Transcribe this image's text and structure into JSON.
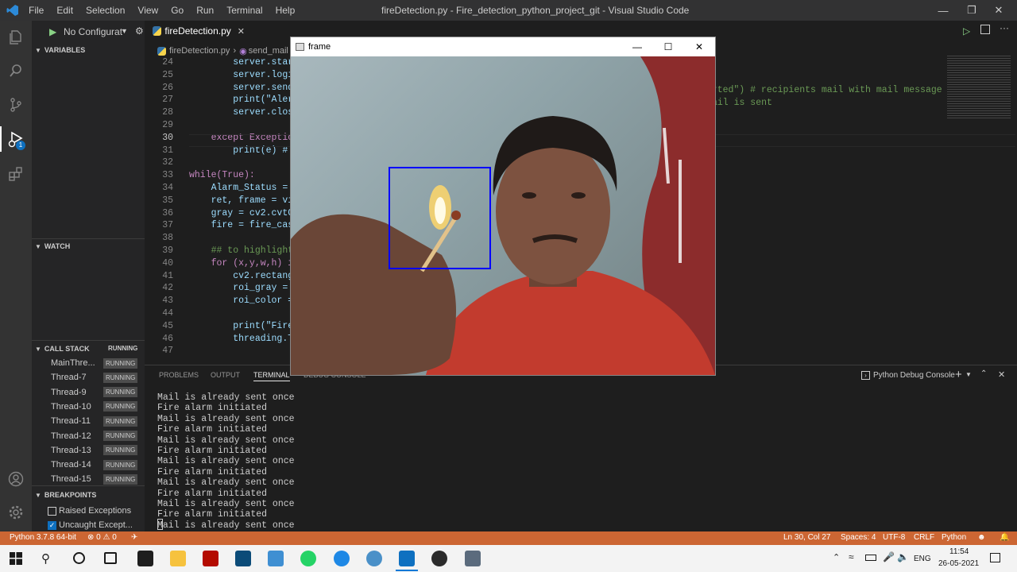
{
  "titlebar": {
    "menu": [
      "File",
      "Edit",
      "Selection",
      "View",
      "Go",
      "Run",
      "Terminal",
      "Help"
    ],
    "title": "fireDetection.py - Fire_detection_python_project_git - Visual Studio Code"
  },
  "debug": {
    "config": "No Configurat",
    "tab_file": "fireDetection.py",
    "breadcrumb_file": "fireDetection.py",
    "breadcrumb_symbol": "send_mail"
  },
  "sidebar": {
    "variables": "VARIABLES",
    "watch": "WATCH",
    "call_stack": "CALL STACK",
    "call_stack_status": "RUNNING",
    "threads": [
      {
        "name": "MainThre...",
        "status": "RUNNING"
      },
      {
        "name": "Thread-7",
        "status": "RUNNING"
      },
      {
        "name": "Thread-9",
        "status": "RUNNING"
      },
      {
        "name": "Thread-10",
        "status": "RUNNING"
      },
      {
        "name": "Thread-11",
        "status": "RUNNING"
      },
      {
        "name": "Thread-12",
        "status": "RUNNING"
      },
      {
        "name": "Thread-13",
        "status": "RUNNING"
      },
      {
        "name": "Thread-14",
        "status": "RUNNING"
      },
      {
        "name": "Thread-15",
        "status": "RUNNING"
      }
    ],
    "breakpoints": "BREAKPOINTS",
    "bp_items": [
      {
        "label": "Raised Exceptions",
        "checked": false
      },
      {
        "label": "Uncaught Except...",
        "checked": true
      }
    ]
  },
  "code": {
    "lines": [
      {
        "n": "24",
        "t": "        server.start"
      },
      {
        "n": "25",
        "t": "        server.login"
      },
      {
        "n": "26",
        "t": "        server.sendm"
      },
      {
        "n": "27",
        "t": "        print(\"Alert"
      },
      {
        "n": "28",
        "t": "        server.close"
      },
      {
        "n": "29",
        "t": ""
      },
      {
        "n": "30",
        "t": "    except Exception"
      },
      {
        "n": "31",
        "t": "        print(e) # T"
      },
      {
        "n": "32",
        "t": ""
      },
      {
        "n": "33",
        "t": "while(True):"
      },
      {
        "n": "34",
        "t": "    Alarm_Status = F"
      },
      {
        "n": "35",
        "t": "    ret, frame = vid"
      },
      {
        "n": "36",
        "t": "    gray = cv2.cvtCo"
      },
      {
        "n": "37",
        "t": "    fire = fire_casc"
      },
      {
        "n": "38",
        "t": ""
      },
      {
        "n": "39",
        "t": "    ## to highlight"
      },
      {
        "n": "40",
        "t": "    for (x,y,w,h) in"
      },
      {
        "n": "41",
        "t": "        cv2.rectangl"
      },
      {
        "n": "42",
        "t": "        roi_gray = g"
      },
      {
        "n": "43",
        "t": "        roi_color ="
      },
      {
        "n": "44",
        "t": ""
      },
      {
        "n": "45",
        "t": "        print(\"Fire"
      },
      {
        "n": "46",
        "t": "        threading.Th"
      },
      {
        "n": "47",
        "t": ""
      }
    ],
    "right_line1": "ported\") # recipients mail with mail message",
    "right_line2": "ail is sent"
  },
  "panel": {
    "tabs": [
      "PROBLEMS",
      "OUTPUT",
      "TERMINAL",
      "DEBUG CONSOLE"
    ],
    "terminal_name": "Python Debug Console",
    "terminal_lines": [
      "Mail is already sent once",
      "Fire alarm initiated",
      "Mail is already sent once",
      "Fire alarm initiated",
      "Mail is already sent once",
      "Fire alarm initiated",
      "Mail is already sent once",
      "Fire alarm initiated",
      "Mail is already sent once",
      "Fire alarm initiated",
      "Mail is already sent once",
      "Fire alarm initiated",
      "Mail is already sent once"
    ]
  },
  "frame_window": {
    "title": "frame"
  },
  "statusbar": {
    "python": "Python 3.7.8 64-bit",
    "errors": "⊗ 0 ⚠ 0",
    "position": "Ln 30, Col 27",
    "spaces": "Spaces: 4",
    "encoding": "UTF-8",
    "eol": "CRLF",
    "language": "Python"
  },
  "taskbar": {
    "lang": "ENG",
    "time": "11:54",
    "date": "26-05-2021"
  },
  "colors": {
    "statusbar": "#cc6633",
    "detection_box": "#0000ff",
    "shirt": "#c23b2e"
  }
}
